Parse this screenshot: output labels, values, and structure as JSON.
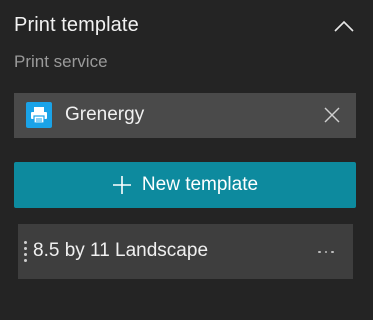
{
  "panel": {
    "title": "Print template",
    "collapse_icon": "chevron-up-icon"
  },
  "print_service": {
    "label": "Print service",
    "selected_value": "Grenergy",
    "icon": "printer-icon",
    "icon_color": "#1aa3e8",
    "clear_icon": "close-icon"
  },
  "new_template_button": {
    "label": "New template",
    "icon": "plus-icon",
    "color": "#0d8a9e"
  },
  "templates": [
    {
      "label": "8.5 by 11 Landscape",
      "drag_icon": "drag-handle-icon",
      "menu_icon": "more-options-icon"
    }
  ]
}
